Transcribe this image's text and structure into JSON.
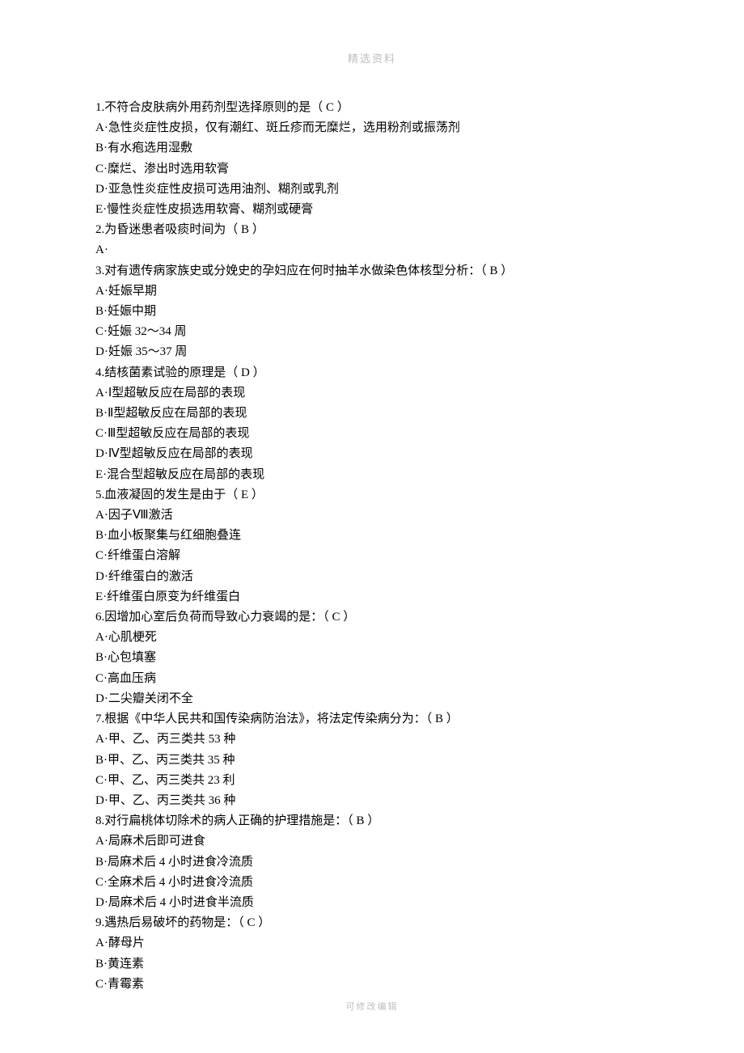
{
  "header": "精选资料",
  "footer": "可修改编辑",
  "lines": [
    "1.不符合皮肤病外用药剂型选择原则的是（   C   ）",
    "A·急性炎症性皮损，仅有潮红、斑丘疹而无糜烂，选用粉剂或振荡剂",
    "B·有水疱选用湿敷",
    "C·糜烂、渗出时选用软膏",
    "D·亚急性炎症性皮损可选用油剂、糊剂或乳剂",
    "E·慢性炎症性皮损选用软膏、糊剂或硬膏",
    "2.为昏迷患者吸痰时间为（  B   ）",
    "A·",
    "3.对有遗传病家族史或分娩史的孕妇应在何时抽羊水做染色体核型分析：（ B    ）",
    "A·妊娠早期",
    "B·妊娠中期",
    "C·妊娠 32～34 周",
    "D·妊娠 35～37 周",
    "4.结核菌素试验的原理是（   D   ）",
    "A·Ⅰ型超敏反应在局部的表现",
    "B·Ⅱ型超敏反应在局部的表现",
    "C·Ⅲ型超敏反应在局部的表现",
    "D·Ⅳ型超敏反应在局部的表现",
    "E·混合型超敏反应在局部的表现",
    "5.血液凝固的发生是由于（   E   ）",
    "A·因子Ⅷ激活",
    "B·血小板聚集与红细胞叠连",
    "C·纤维蛋白溶解",
    "D·纤维蛋白的激活",
    "E·纤维蛋白原变为纤维蛋白",
    "6.因增加心室后负荷而导致心力衰竭的是：（   C   ）",
    "A·心肌梗死",
    "B·心包填塞",
    "C·高血压病",
    "D·二尖瓣关闭不全",
    "7.根据《中华人民共和国传染病防治法》，将法定传染病分为：（  B    ）",
    "A·甲、乙、丙三类共 53 种",
    "B·甲、乙、丙三类共 35 种",
    "C·甲、乙、丙三类共 23 利",
    "D·甲、乙、丙三类共 36 种",
    "8.对行扁桃体切除术的病人正确的护理措施是：（  B    ）",
    "A·局麻术后即可进食",
    "B·局麻术后 4 小时进食冷流质",
    "C·全麻术后 4 小时进食冷流质",
    "D·局麻术后 4 小时进食半流质",
    "9.遇热后易破坏的药物是：（   C  ）",
    "A·酵母片",
    "B·黄连素",
    "C·青霉素"
  ]
}
